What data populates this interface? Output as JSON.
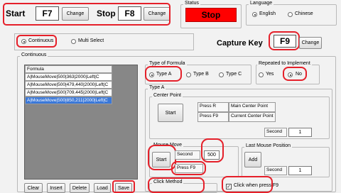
{
  "start": {
    "label": "Start",
    "key": "F7",
    "change": "Change"
  },
  "stop": {
    "label": "Stop",
    "key": "F8",
    "change": "Change"
  },
  "status": {
    "group_label": "Status",
    "value": "Stop"
  },
  "language": {
    "group_label": "Language",
    "options": [
      "English",
      "Chinese"
    ],
    "selected": "English"
  },
  "mode": {
    "continuous": "Continuous",
    "multi_select": "Multi Select",
    "selected": "Continuous"
  },
  "capture": {
    "label": "Capture Key",
    "key": "F9",
    "change": "Change"
  },
  "continuous_group": {
    "label": "Continuous"
  },
  "formula_list": {
    "header": "Formula",
    "rows": [
      "A|MouseMove|500|363|2000|Left|C",
      "A|MouseMove|500|479,440|2000|Left|C",
      "A|MouseMove|500|709,445|2000|Left|C",
      "A|MouseMove|500|850,211|2000|Left|C"
    ],
    "selected_index": 3
  },
  "list_buttons": [
    "Clear",
    "Insert",
    "Delete",
    "Load",
    "Save"
  ],
  "type_formula": {
    "label": "Type of Formula",
    "options": [
      "Type A",
      "Type B",
      "Type C"
    ],
    "selected": "Type A"
  },
  "repeat": {
    "label": "Repeated to Implement",
    "options": [
      "Yes",
      "No"
    ],
    "selected": "No"
  },
  "type_a": {
    "label": "Type A",
    "center_point": {
      "label": "Center Point",
      "start": "Start",
      "press_r": "Press R",
      "press_f9": "Press F9",
      "main_center": "Main Center Point",
      "current_center": "Current Center Point",
      "second_label": "Second",
      "second_value": "1"
    },
    "mouse_move": {
      "label": "Mouse Move",
      "start": "Start",
      "second_label": "Second",
      "second_value": "500",
      "press_f9": "Press F9"
    },
    "last_mouse": {
      "label": "Last Mouse Position",
      "add": "Add",
      "second_label": "Second",
      "second_value": "1"
    },
    "click_method": {
      "label": "Click Method"
    },
    "click_when": {
      "label": "Click when press F9"
    }
  },
  "colors": {
    "status_bg": "#ff0000",
    "selection": "#3b78d8",
    "annotation": "#e5202a"
  }
}
